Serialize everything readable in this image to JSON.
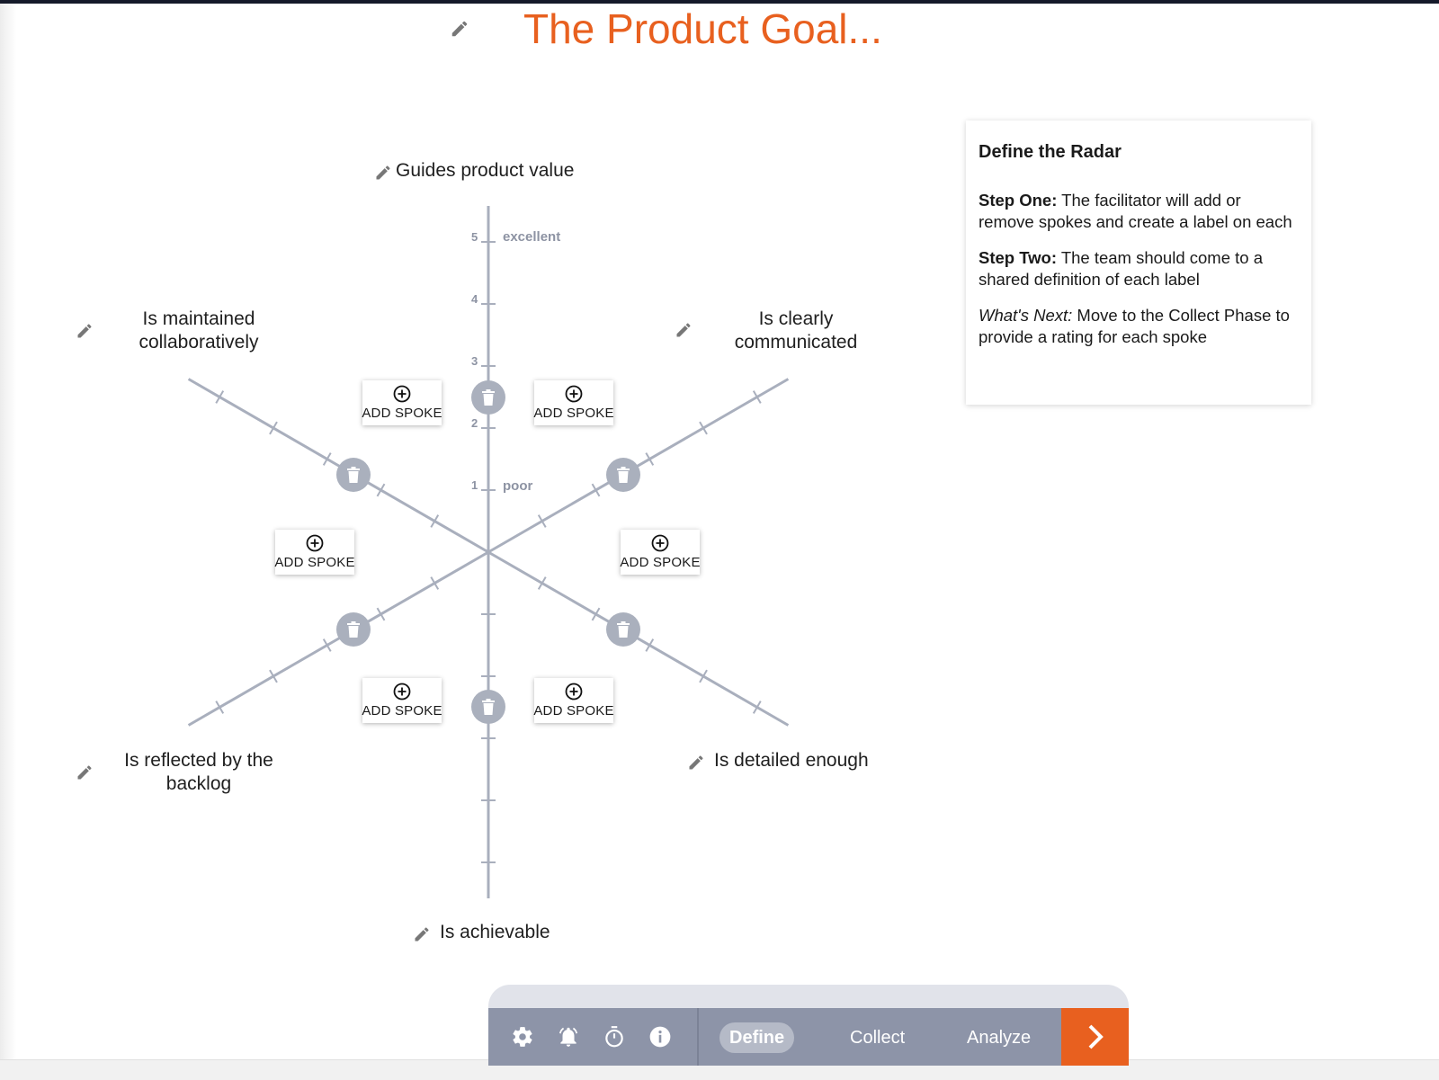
{
  "title": "The Product Goal...",
  "spokes": [
    {
      "label": "Guides product value"
    },
    {
      "label": "Is clearly communicated"
    },
    {
      "label": "Is detailed enough"
    },
    {
      "label": "Is achievable"
    },
    {
      "label": "Is reflected by the backlog"
    },
    {
      "label": "Is maintained collaboratively"
    }
  ],
  "spoke_labels_display": {
    "top": "Guides product value",
    "top_right_l1": "Is clearly",
    "top_right_l2": "communicated",
    "bottom_right": "Is detailed enough",
    "bottom": "Is achievable",
    "bottom_left_l1": "Is reflected by the",
    "bottom_left_l2": "backlog",
    "top_left_l1": "Is maintained",
    "top_left_l2": "collaboratively"
  },
  "scale": {
    "ticks": [
      "1",
      "2",
      "3",
      "4",
      "5"
    ],
    "low_label": "poor",
    "high_label": "excellent"
  },
  "add_spoke_label": "ADD SPOKE",
  "info_card": {
    "heading": "Define the Radar",
    "step_one_label": "Step One:",
    "step_one_text": " The facilitator will add or remove spokes and create a label on each",
    "step_two_label": "Step Two:",
    "step_two_text": " The team should come to a shared definition of each label",
    "next_label": "What's Next:",
    "next_text": " Move to the Collect Phase to provide a rating for each spoke"
  },
  "toolbar": {
    "icons": [
      "gear-icon",
      "alarm-bell-icon",
      "timer-icon",
      "info-icon"
    ],
    "phases": [
      "Define",
      "Collect",
      "Analyze"
    ],
    "active_phase": "Define"
  },
  "colors": {
    "accent": "#e8601f",
    "axis": "#a9afbd",
    "toolbar": "#8d94a8"
  }
}
